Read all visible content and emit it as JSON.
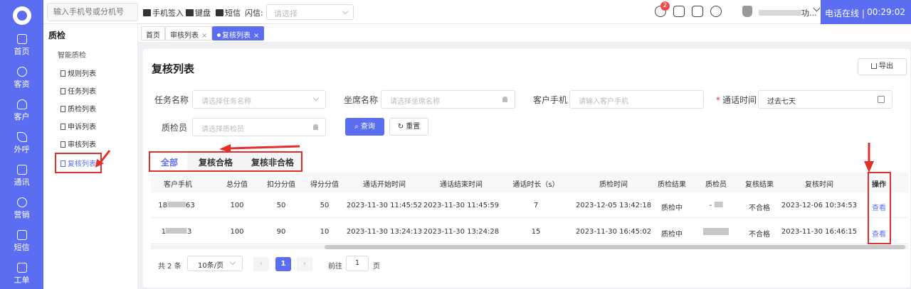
{
  "rail": {
    "items": [
      {
        "label": "首页",
        "icon": "home-icon"
      },
      {
        "label": "客资",
        "icon": "leads-icon"
      },
      {
        "label": "客户",
        "icon": "customer-icon"
      },
      {
        "label": "外呼",
        "icon": "outbound-call-icon"
      },
      {
        "label": "通讯",
        "icon": "contacts-icon"
      },
      {
        "label": "营销",
        "icon": "marketing-icon"
      },
      {
        "label": "短信",
        "icon": "sms-icon"
      },
      {
        "label": "工单",
        "icon": "ticket-icon"
      }
    ]
  },
  "topbar": {
    "phone_placeholder": "输入手机号或分机号",
    "sign_in": "手机签入",
    "keypad": "键盘",
    "sms": "短信",
    "flash_label": "闪信:",
    "flash_placeholder": "请选择",
    "notification_count": "2",
    "user_name": "功...",
    "status": "电话在线 |",
    "timer": "00:29:02"
  },
  "subnav": {
    "title": "质检",
    "group": "智能质检",
    "items": [
      "规则列表",
      "任务列表",
      "质检列表",
      "申诉列表",
      "审核列表",
      "复核列表"
    ]
  },
  "tabs": [
    {
      "label": "首页"
    },
    {
      "label": "审核列表",
      "close": "×"
    },
    {
      "label": "复核列表",
      "close": "×"
    }
  ],
  "page": {
    "title": "复核列表",
    "export_label": "导出"
  },
  "filters": {
    "task_name_label": "任务名称",
    "task_name_placeholder": "请选择任务名称",
    "agent_name_label": "坐席名称",
    "agent_name_placeholder": "请选择坐席名称",
    "customer_phone_label": "客户手机",
    "customer_phone_placeholder": "请输入客户手机",
    "call_time_label": "通话时间",
    "call_time_required": "*",
    "call_time_value": "过去七天",
    "inspector_label": "质检员",
    "inspector_placeholder": "请选择质检员",
    "query_label": "查询",
    "reset_label": "重置"
  },
  "result_tabs": [
    "全部",
    "复核合格",
    "复核非合格"
  ],
  "table": {
    "columns": [
      "客户手机",
      "总分值",
      "扣分分值",
      "得分分值",
      "通话开始时间",
      "通话结束时间",
      "通话时长（s）",
      "质检时间",
      "质检结果",
      "质检员",
      "复核结果",
      "复核时间",
      "操作"
    ],
    "rows": [
      {
        "phone_prefix": "18",
        "phone_suffix": "63",
        "total": "100",
        "deduct": "50",
        "score": "50",
        "start": "2023-11-30 11:45:52",
        "end": "2023-11-30 11:45:59",
        "duration": "7",
        "qc_time": "2023-12-05 13:42:18",
        "qc_result": "质检中",
        "inspector": "-",
        "review_result": "不合格",
        "review_time": "2023-12-06 10:34:53",
        "action": "查看"
      },
      {
        "phone_prefix": "1",
        "phone_suffix": "3",
        "total": "100",
        "deduct": "90",
        "score": "10",
        "start": "2023-11-30 13:24:13",
        "end": "2023-11-30 13:24:28",
        "duration": "15",
        "qc_time": "2023-11-30 16:45:02",
        "qc_result": "质检中",
        "inspector": "",
        "review_result": "不合格",
        "review_time": "2023-11-30 16:46:15",
        "action": "查看"
      }
    ]
  },
  "pagination": {
    "total": "共 2 条",
    "page_size": "10条/页",
    "prev": "‹",
    "current": "1",
    "next": "›",
    "goto_label": "前往",
    "goto_value": "1",
    "page_suffix": "页"
  },
  "colors": {
    "accent": "#5b6ef2",
    "annotation_red": "#e0302c"
  }
}
